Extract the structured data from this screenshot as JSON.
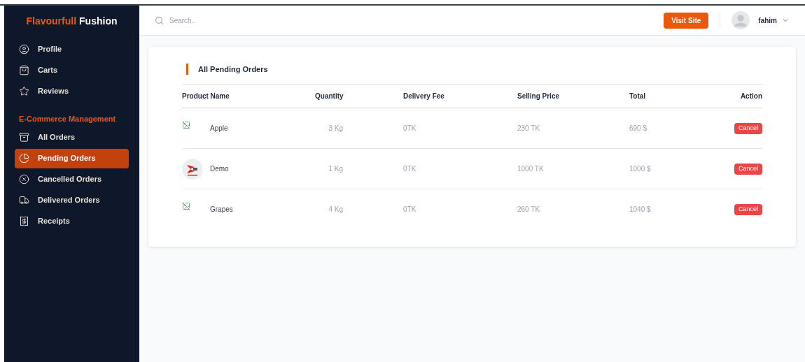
{
  "brand": {
    "first": "Flavourfull",
    "second": "Fushion"
  },
  "sidebar": {
    "items": [
      {
        "label": "Profile",
        "selected": false
      },
      {
        "label": "Carts",
        "selected": false
      },
      {
        "label": "Reviews",
        "selected": false
      }
    ],
    "section": "E-Commerce Management",
    "section_items": [
      {
        "label": "All Orders",
        "selected": false
      },
      {
        "label": "Pending Orders",
        "selected": true
      },
      {
        "label": "Cancelled Orders",
        "selected": false
      },
      {
        "label": "Delivered Orders",
        "selected": false
      },
      {
        "label": "Receipts",
        "selected": false
      }
    ]
  },
  "header": {
    "search_placeholder": "Search..",
    "visit_button": "Visit Site",
    "user": "fahim"
  },
  "card": {
    "title": "All Pending Orders",
    "columns": [
      "Product Name",
      "Quantity",
      "Delivery Fee",
      "Selling Price",
      "Total",
      "Action"
    ],
    "rows": [
      {
        "kind": "broken",
        "name": "Apple",
        "quantity": "3 Kg",
        "delivery_fee": "0TK",
        "selling_price": "230 TK",
        "total": "690 $",
        "action": "Cancel"
      },
      {
        "kind": "picture",
        "name": "Demo",
        "quantity": "1 Kg",
        "delivery_fee": "0TK",
        "selling_price": "1000 TK",
        "total": "1000 $",
        "action": "Cancel"
      },
      {
        "kind": "broken",
        "name": "Grapes",
        "quantity": "4 Kg",
        "delivery_fee": "0TK",
        "selling_price": "260 TK",
        "total": "1040 $",
        "action": "Cancel"
      }
    ]
  }
}
